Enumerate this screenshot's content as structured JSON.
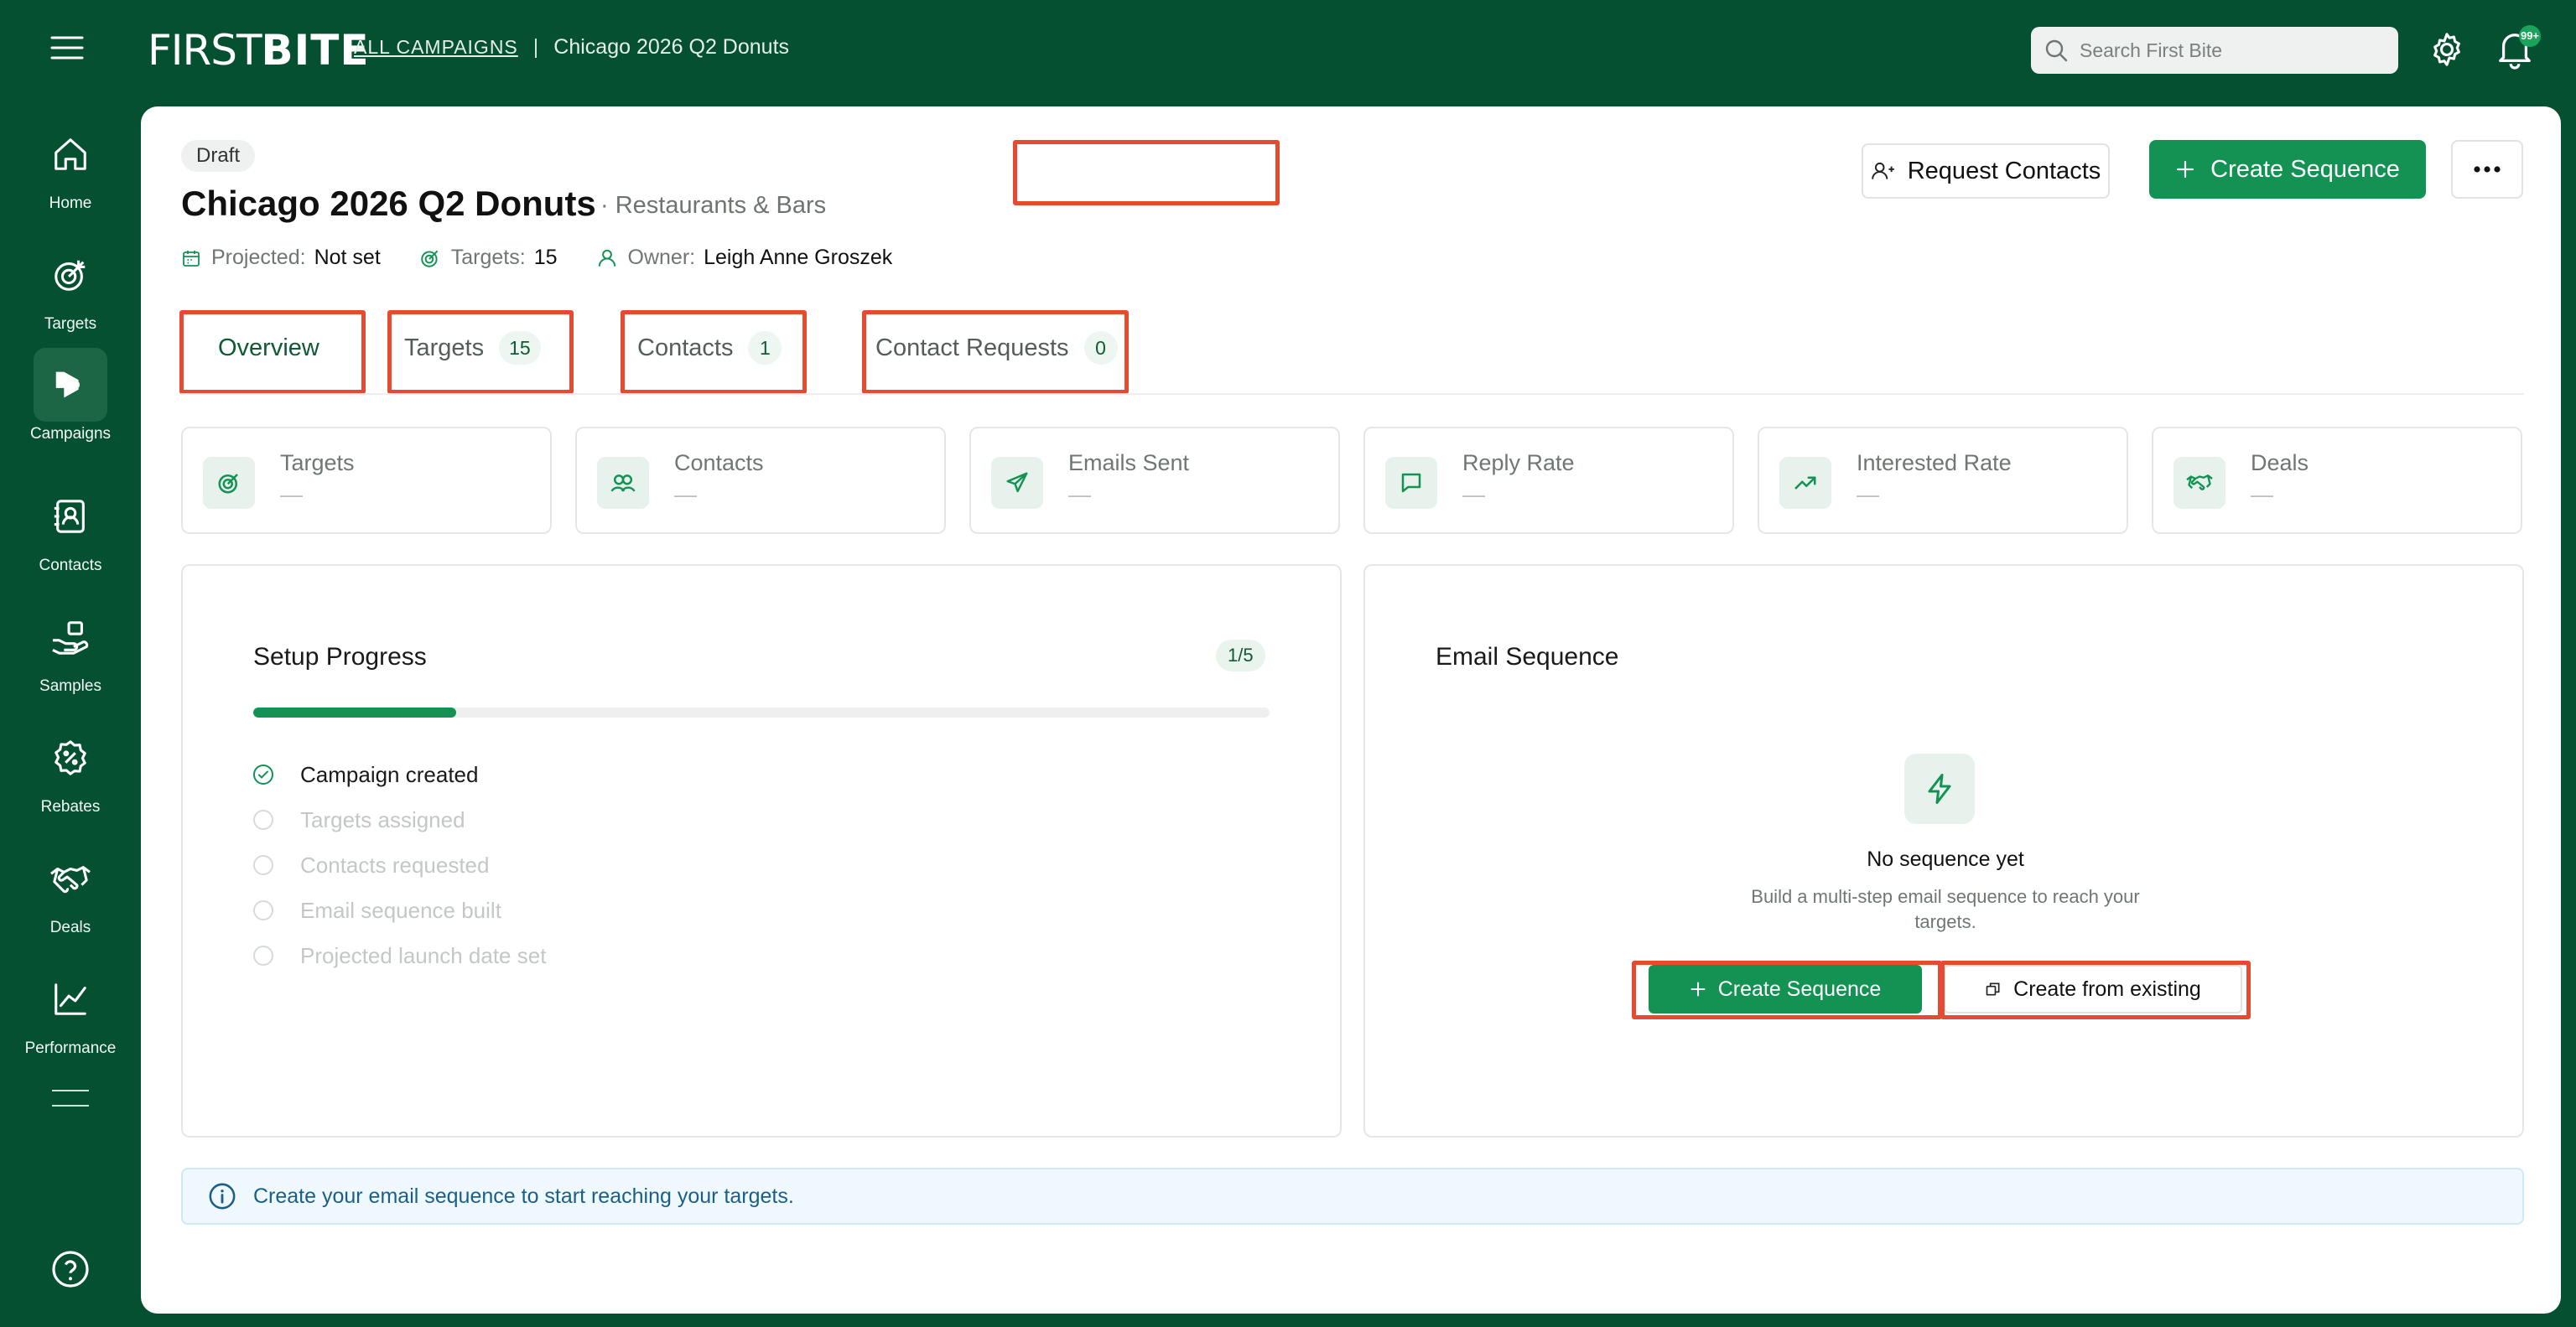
{
  "brand": {
    "logo_thin": "FIRST",
    "logo_bold": "BITE"
  },
  "breadcrumb": {
    "all_campaigns": "ALL CAMPAIGNS",
    "separator": "|",
    "current": "Chicago 2026 Q2 Donuts"
  },
  "search": {
    "placeholder": "Search First Bite"
  },
  "notifications": {
    "badge": "99+"
  },
  "sidebar": {
    "items": [
      {
        "label": "Home",
        "icon": "home-icon"
      },
      {
        "label": "Targets",
        "icon": "target-icon"
      },
      {
        "label": "Campaigns",
        "icon": "megaphone-icon",
        "active": true
      },
      {
        "label": "Contacts",
        "icon": "contact-book-icon"
      },
      {
        "label": "Samples",
        "icon": "hand-box-icon"
      },
      {
        "label": "Rebates",
        "icon": "percent-badge-icon"
      },
      {
        "label": "Deals",
        "icon": "handshake-icon"
      },
      {
        "label": "Performance",
        "icon": "line-chart-icon"
      }
    ]
  },
  "campaign": {
    "status": "Draft",
    "title": "Chicago 2026 Q2 Donuts",
    "category": "· Restaurants & Bars",
    "projected_label": "Projected:",
    "projected_value": "Not set",
    "targets_label": "Targets:",
    "targets_value": "15",
    "owner_label": "Owner:",
    "owner_value": "Leigh Anne Groszek"
  },
  "actions": {
    "request_contacts": "Request Contacts",
    "create_sequence": "Create Sequence"
  },
  "tabs": [
    {
      "label": "Overview",
      "count": null,
      "active": true
    },
    {
      "label": "Targets",
      "count": "15"
    },
    {
      "label": "Contacts",
      "count": "1"
    },
    {
      "label": "Contact Requests",
      "count": "0"
    }
  ],
  "stats": [
    {
      "label": "Targets",
      "value": "—",
      "icon": "target-icon"
    },
    {
      "label": "Contacts",
      "value": "—",
      "icon": "users-icon"
    },
    {
      "label": "Emails Sent",
      "value": "—",
      "icon": "send-icon"
    },
    {
      "label": "Reply Rate",
      "value": "—",
      "icon": "message-icon"
    },
    {
      "label": "Interested Rate",
      "value": "—",
      "icon": "trending-up-icon"
    },
    {
      "label": "Deals",
      "value": "—",
      "icon": "handshake-icon"
    }
  ],
  "setup": {
    "title": "Setup Progress",
    "badge": "1/5",
    "progress_fraction": 0.2,
    "steps": [
      {
        "label": "Campaign created",
        "done": true
      },
      {
        "label": "Targets assigned",
        "done": false
      },
      {
        "label": "Contacts requested",
        "done": false
      },
      {
        "label": "Email sequence built",
        "done": false
      },
      {
        "label": "Projected launch date set",
        "done": false
      }
    ]
  },
  "email_sequence": {
    "title": "Email Sequence",
    "empty_title": "No sequence yet",
    "empty_desc": "Build a multi-step email sequence to reach your targets.",
    "create_label": "Create Sequence",
    "from_existing_label": "Create from existing"
  },
  "info_banner": "Create your email sequence to start reaching your targets.",
  "colors": {
    "brand_dark": "#065032",
    "primary": "#139254",
    "highlight": "#e64a31"
  }
}
